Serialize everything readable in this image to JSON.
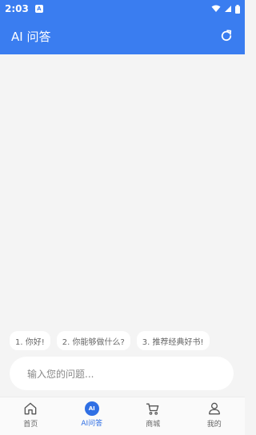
{
  "status_bar": {
    "time": "2:03",
    "app_badge": "A"
  },
  "header": {
    "title": "AI 问答"
  },
  "suggestions": [
    {
      "label": "1. 你好!"
    },
    {
      "label": "2. 你能够做什么?"
    },
    {
      "label": "3. 推荐经典好书!"
    }
  ],
  "input": {
    "placeholder": "输入您的问题..."
  },
  "tabbar": {
    "tabs": [
      {
        "label": "首页",
        "icon": "home-icon"
      },
      {
        "label": "AI问答",
        "icon": "ai-icon",
        "badge": "AI"
      },
      {
        "label": "商城",
        "icon": "cart-icon"
      },
      {
        "label": "我的",
        "icon": "user-icon"
      }
    ]
  },
  "colors": {
    "primary": "#3a7df0",
    "active": "#2f6fe4"
  }
}
